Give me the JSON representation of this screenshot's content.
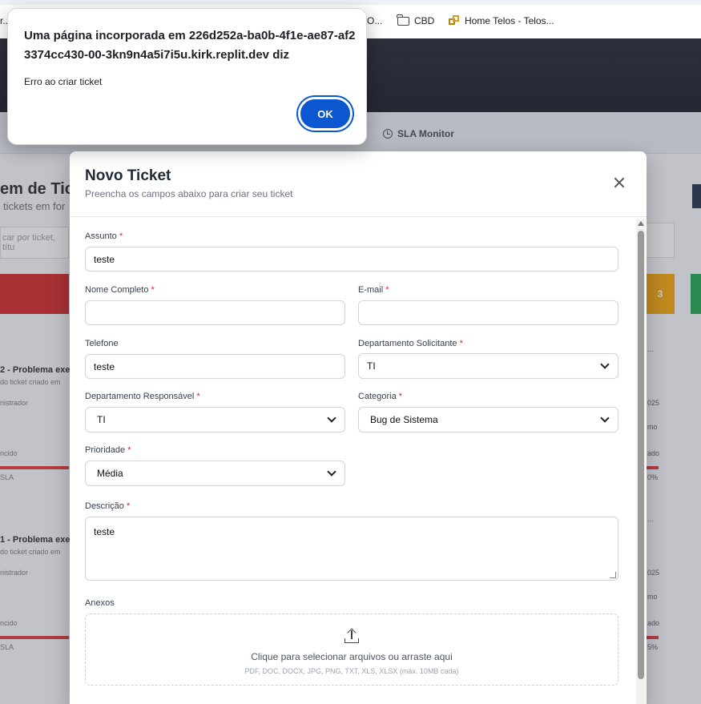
{
  "bookmarks": [
    {
      "label": "r..."
    },
    {
      "label": "O..."
    },
    {
      "label": "CBD"
    },
    {
      "label": "Home Telos - Telos..."
    }
  ],
  "background": {
    "nav_sla": "SLA Monitor",
    "title": "em de Tic",
    "subtitle": "tickets em for",
    "search_placeholder": "car por ticket, títu",
    "orange_count": "3",
    "cards": [
      {
        "title": "2 - Problema exe",
        "sub": "do ticket criado em",
        "owner": "nistrador",
        "status": "ncido",
        "sla": "SLA",
        "r1": "...",
        "r2": "025",
        "r3": "mo",
        "r4": "ado",
        "r5": "0%"
      },
      {
        "title": "1 - Problema exe",
        "sub": "do ticket criado em",
        "owner": "nistrador",
        "status": "ncido",
        "sla": "SLA",
        "r1": "...",
        "r2": "025",
        "r3": "mo",
        "r4": "ado",
        "r5": "5%"
      }
    ]
  },
  "modal": {
    "title": "Novo Ticket",
    "subtitle": "Preencha os campos abaixo para criar seu ticket",
    "fields": {
      "assunto": {
        "label": "Assunto",
        "value": "teste"
      },
      "nome": {
        "label": "Nome Completo",
        "value": ""
      },
      "email": {
        "label": "E-mail",
        "value": ""
      },
      "telefone": {
        "label": "Telefone",
        "value": "teste"
      },
      "dept_solicitante": {
        "label": "Departamento Solicitante",
        "value": "TI"
      },
      "dept_responsavel": {
        "label": "Departamento Responsável",
        "value": "TI"
      },
      "categoria": {
        "label": "Categoria",
        "value": "Bug de Sistema"
      },
      "prioridade": {
        "label": "Prioridade",
        "value": "Média"
      },
      "descricao": {
        "label": "Descrição",
        "value": "teste"
      },
      "anexos": {
        "label": "Anexos",
        "prompt": "Clique para selecionar arquivos ou arraste aqui",
        "hint": "PDF, DOC, DOCX, JPG, PNG, TXT, XLS, XLSX (máx. 10MB cada)"
      }
    },
    "required_mark": "*"
  },
  "alert": {
    "title": "Uma página incorporada em 226d252a-ba0b-4f1e-ae87-af23374cc430-00-3kn9n4a5i7i5u.kirk.replit.dev diz",
    "message": "Erro ao criar ticket",
    "ok_label": "OK",
    "accent": "#0b57d0"
  }
}
